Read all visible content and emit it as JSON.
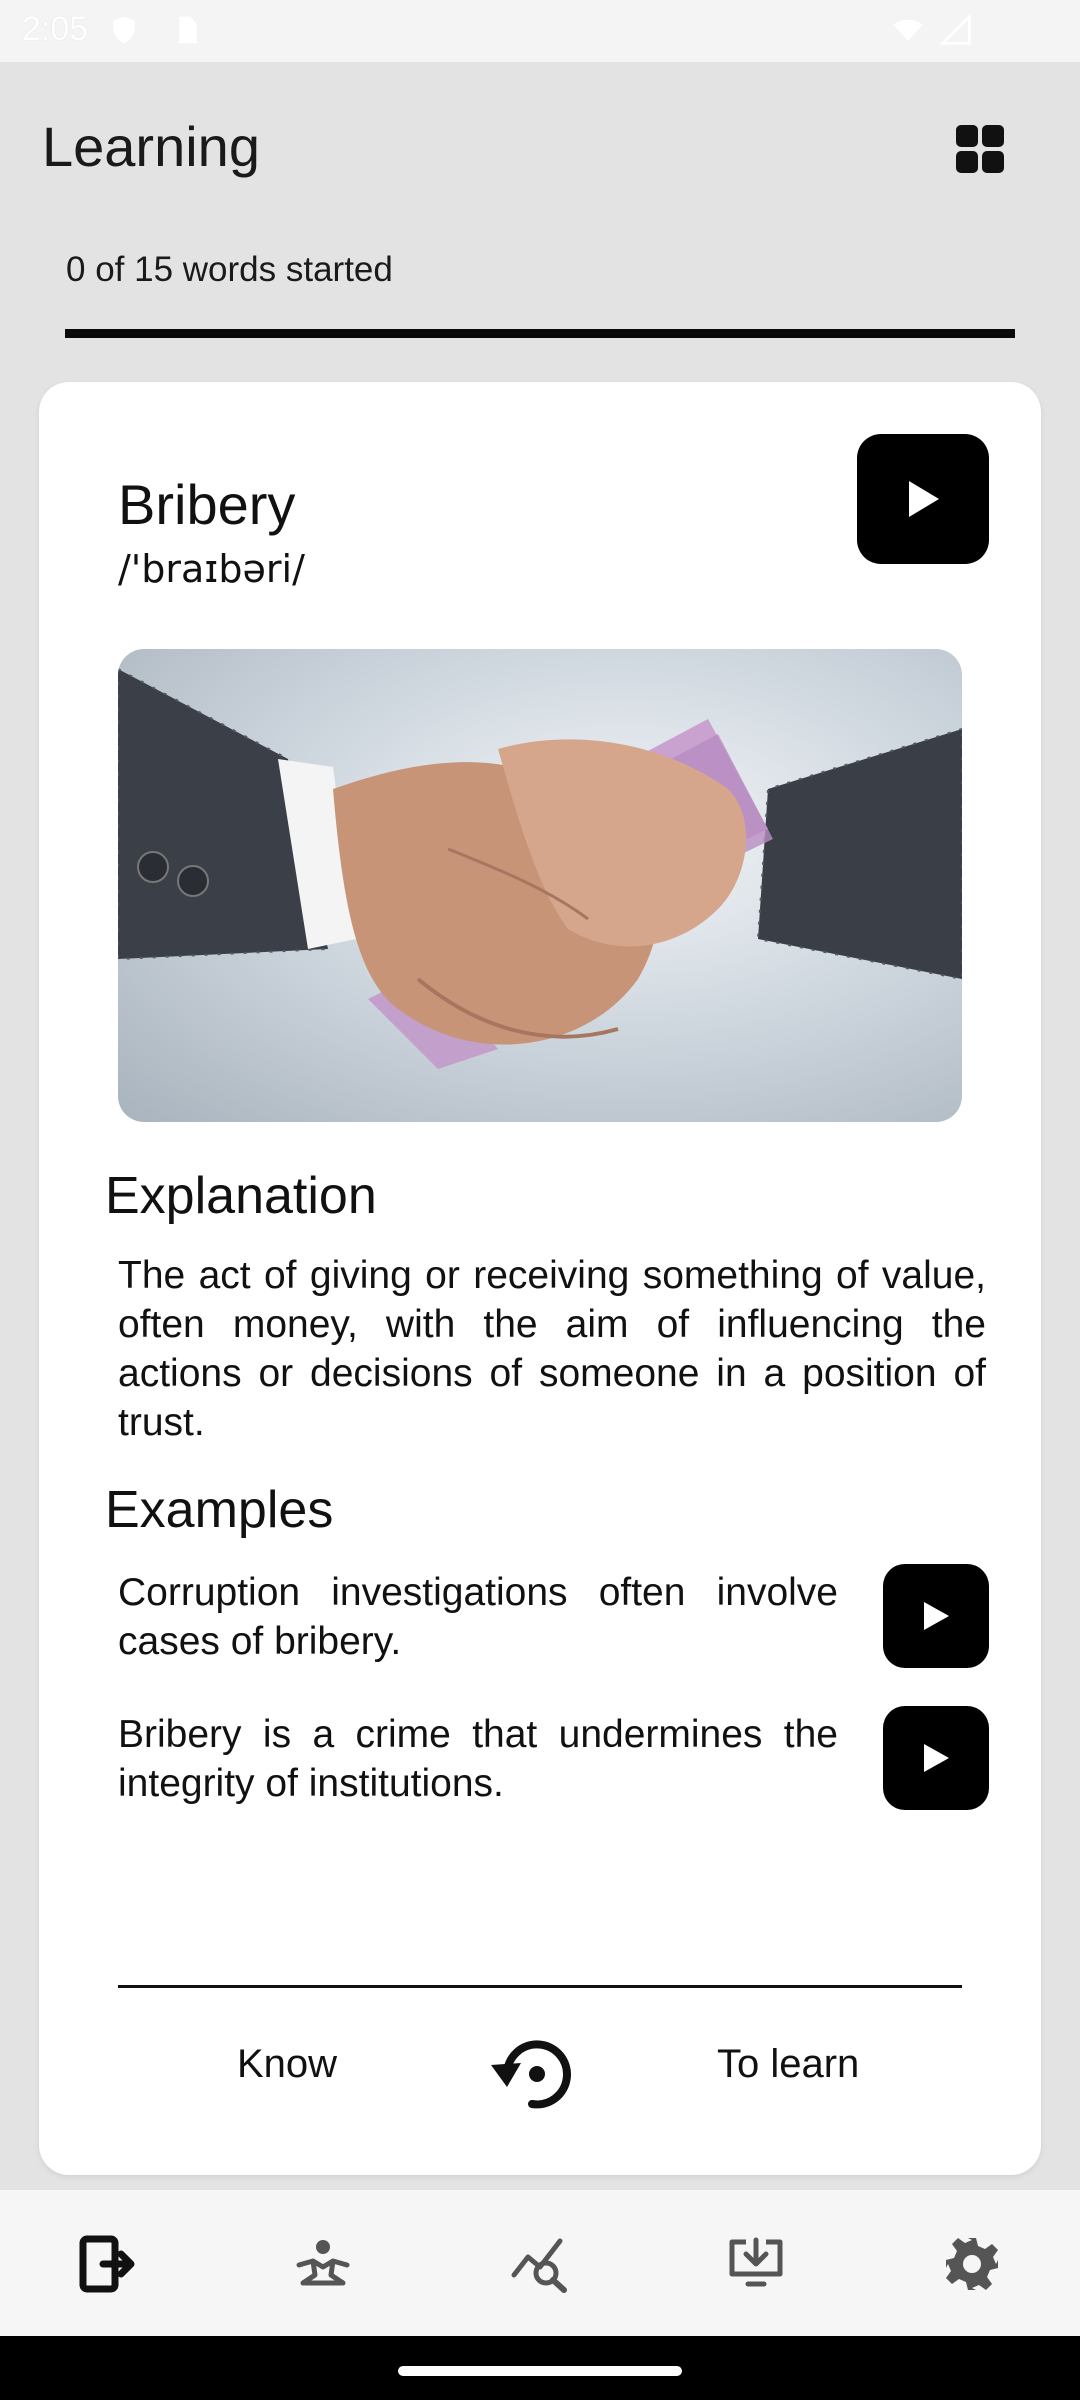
{
  "status_bar": {
    "time": "2:05"
  },
  "header": {
    "title": "Learning"
  },
  "progress": {
    "label": "0 of 15 words started",
    "started": 0,
    "total": 15,
    "fill_fraction": 1.0
  },
  "card": {
    "word": "Bribery",
    "phonetic": "/'braɪbəri/",
    "image_alt": "Handshake with banknotes",
    "explanation_heading": "Explanation",
    "explanation": "The act of giving or receiving something of value, often money, with the aim of influencing the actions or decisions of someone in a position of trust.",
    "examples_heading": "Examples",
    "examples": [
      "Corruption investigations often involve cases of bribery.",
      "Bribery is a crime that undermines the integrity of institutions."
    ],
    "know_label": "Know",
    "to_learn_label": "To learn"
  },
  "bottom_nav": {
    "items": [
      "learn-icon",
      "practice-icon",
      "progress-search-icon",
      "download-icon",
      "settings-icon"
    ],
    "active_index": 0
  },
  "colors": {
    "accent": "#000000",
    "background": "#e3e3e3",
    "card": "#ffffff"
  }
}
